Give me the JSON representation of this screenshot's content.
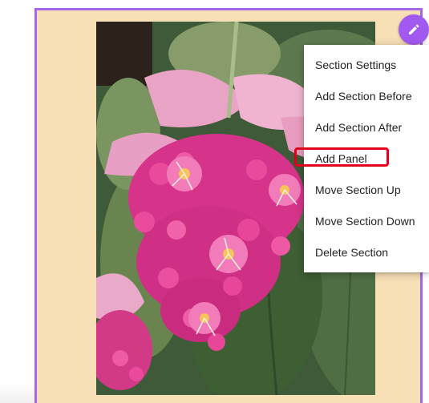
{
  "menu": {
    "items": [
      {
        "label": "Section Settings"
      },
      {
        "label": "Add Section Before"
      },
      {
        "label": "Add Section After"
      },
      {
        "label": "Add Panel",
        "highlighted": true
      },
      {
        "label": "Move Section Up"
      },
      {
        "label": "Move Section Down"
      },
      {
        "label": "Delete Section"
      }
    ]
  },
  "icons": {
    "edit": "pencil-icon"
  },
  "colors": {
    "section_background": "#f7dfb6",
    "section_border": "#a865e8",
    "edit_button": "#a259f0",
    "highlight_outline": "#e0001b"
  }
}
